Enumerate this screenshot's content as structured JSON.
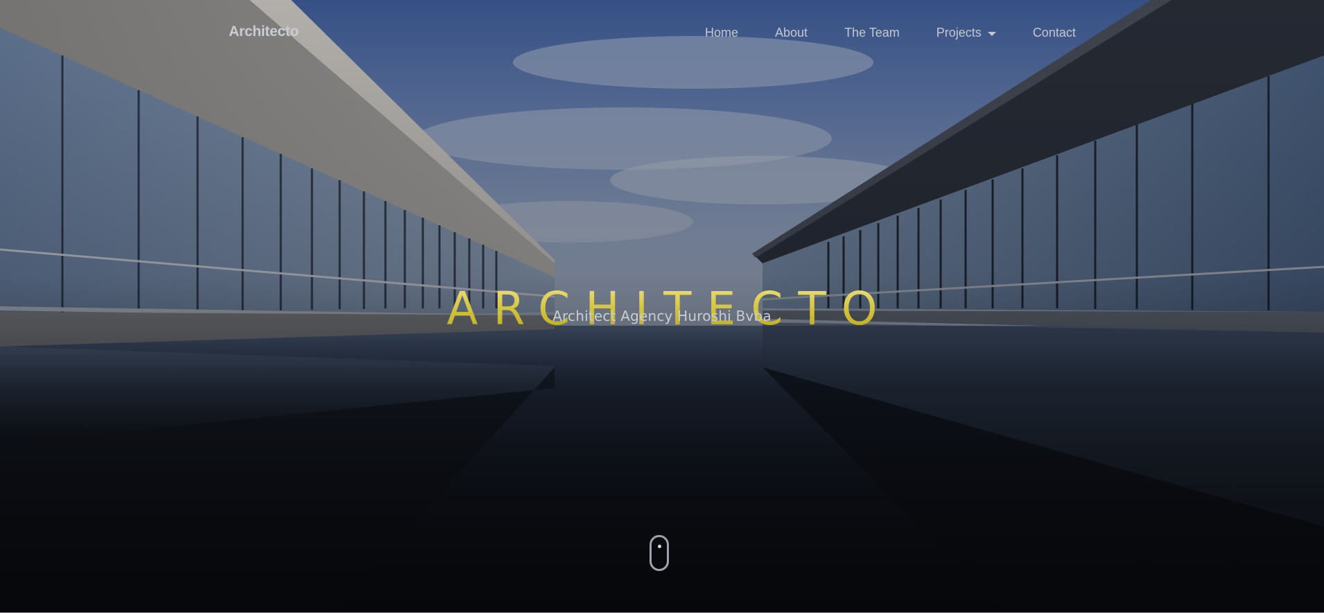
{
  "navbar": {
    "brand": "Architecto",
    "links": [
      {
        "label": "Home"
      },
      {
        "label": "About"
      },
      {
        "label": "The Team"
      },
      {
        "label": "Projects",
        "has_dropdown": true,
        "icon": "caret-down-icon"
      },
      {
        "label": "Contact"
      }
    ]
  },
  "hero": {
    "title": "ARCHITECTO",
    "subtitle": "Architect Agency Huroshi Bvba",
    "background": "glass-buildings-reflecting-pool-image",
    "scroll_indicator": "mouse-scroll-icon"
  },
  "colors": {
    "title_gold": "#d4c33e",
    "nav_text": "#c3c7d0",
    "sky": "#5f7bb3",
    "water": "#0b0d12"
  }
}
